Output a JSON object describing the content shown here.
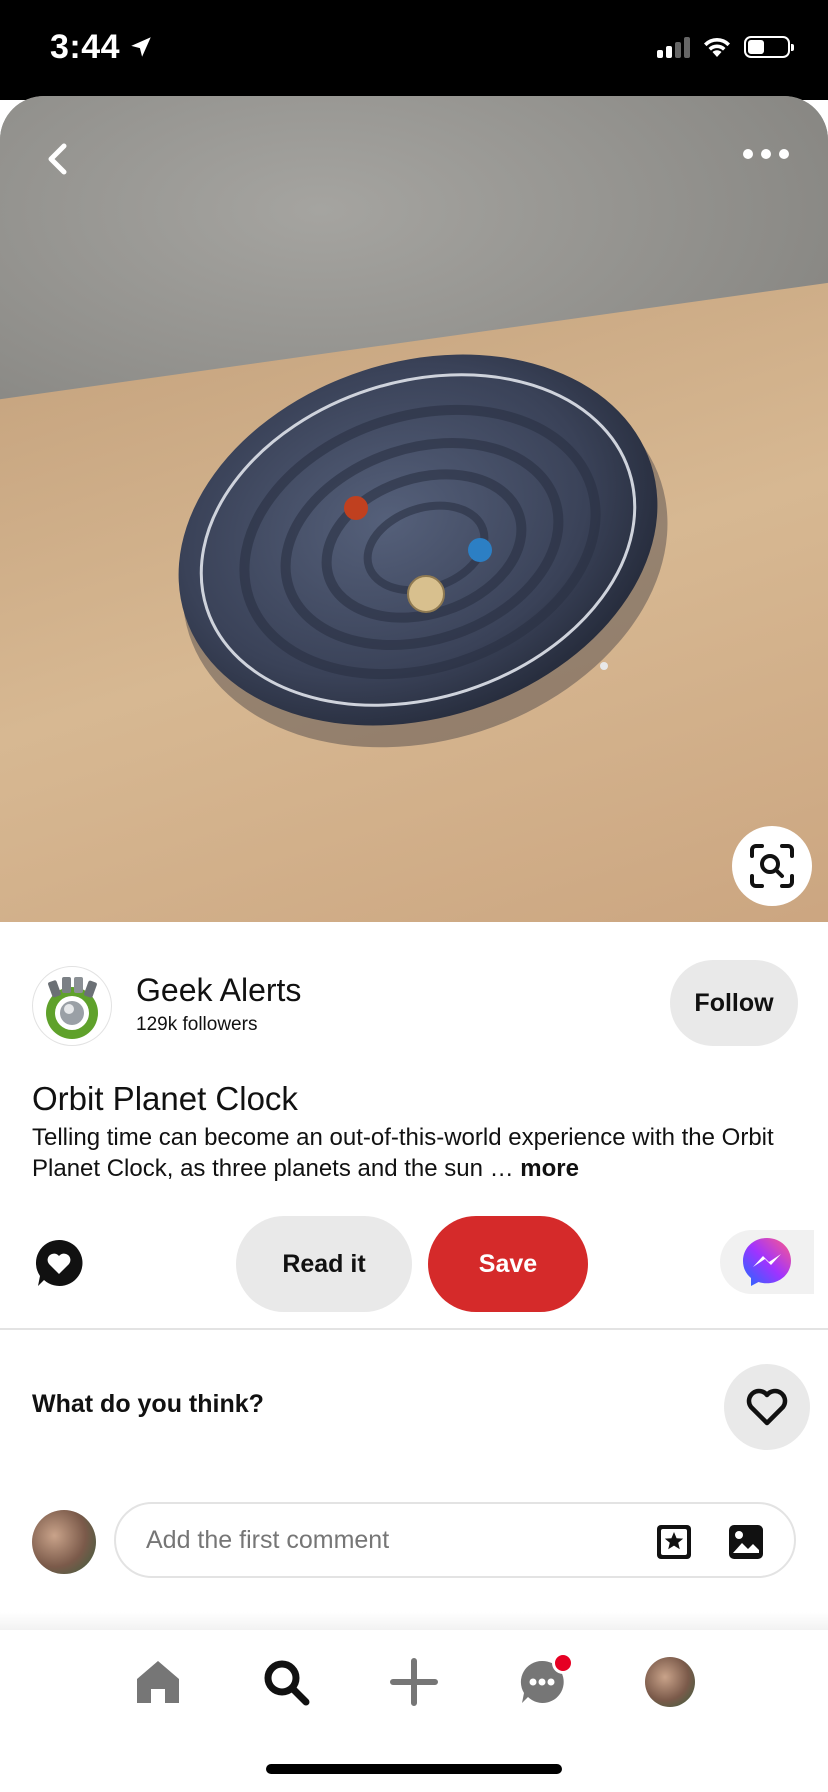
{
  "status_bar": {
    "time": "3:44"
  },
  "creator": {
    "name": "Geek Alerts",
    "followers": "129k followers",
    "follow_label": "Follow"
  },
  "pin": {
    "title": "Orbit Planet Clock",
    "description": "Telling time can become an out-of-this-world experience with the Orbit Planet Clock, as three planets and the sun …",
    "more_label": "more"
  },
  "actions": {
    "read_label": "Read it",
    "save_label": "Save"
  },
  "feedback": {
    "prompt": "What do you think?"
  },
  "comment": {
    "placeholder": "Add the first comment"
  },
  "colors": {
    "save": "#d52a2a",
    "badge": "#e60023",
    "pill": "#e9e9e9"
  },
  "icons": [
    "location-arrow-icon",
    "signal-icon",
    "wifi-icon",
    "battery-icon",
    "back-chevron-icon",
    "more-dots-icon",
    "visual-search-icon",
    "reaction-heart-icon",
    "messenger-icon",
    "heart-outline-icon",
    "sticker-icon",
    "image-icon",
    "home-icon",
    "search-icon",
    "plus-icon",
    "messages-icon"
  ]
}
